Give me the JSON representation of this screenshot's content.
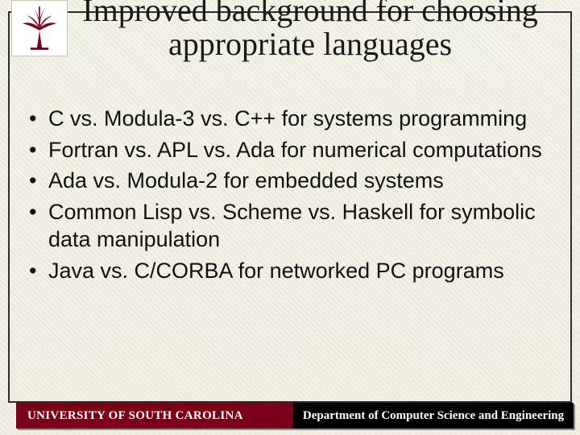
{
  "title": "Improved background for choosing appropriate languages",
  "bullets": [
    "C vs. Modula-3 vs. C++ for systems programming",
    "Fortran vs. APL vs. Ada for numerical computations",
    "Ada vs. Modula-2 for embedded systems",
    "Common Lisp vs. Scheme vs. Haskell for symbolic data manipulation",
    "Java vs. C/CORBA for networked PC programs"
  ],
  "footer": {
    "left": "UNIVERSITY OF SOUTH CAROLINA",
    "right": "Department of Computer Science and Engineering"
  }
}
